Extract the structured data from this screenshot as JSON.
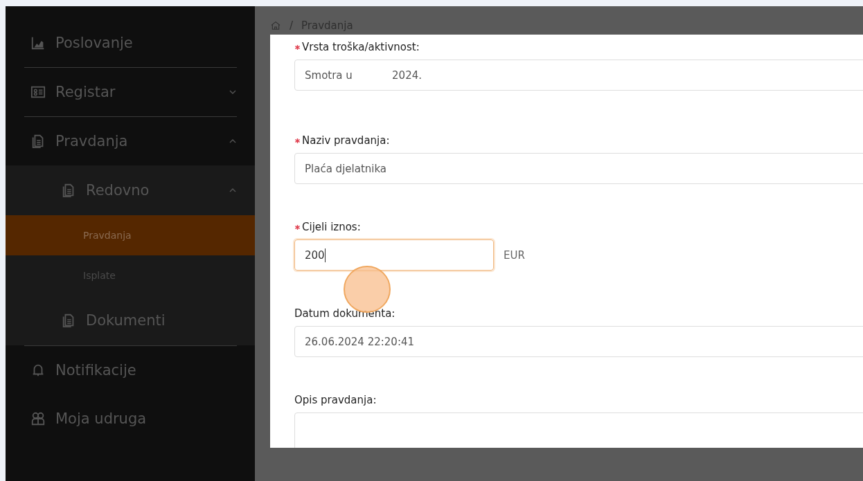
{
  "sidebar": {
    "items": [
      {
        "label": "Poslovanje",
        "divider": true
      },
      {
        "label": "Registar",
        "expanded": false,
        "divider": true
      },
      {
        "label": "Pravdanja",
        "expanded": true,
        "divider": true,
        "children": [
          {
            "label": "Redovno",
            "expanded": true,
            "children": [
              {
                "label": "Pravdanja",
                "selected": true
              },
              {
                "label": "Isplate",
                "selected": false
              }
            ]
          },
          {
            "label": "Dokumenti"
          }
        ]
      },
      {
        "label": "Notifikacije"
      },
      {
        "label": "Moja udruga"
      }
    ]
  },
  "breadcrumb": {
    "separator": "/",
    "items": [
      "Pravdanja"
    ]
  },
  "form": {
    "fields": [
      {
        "kind": "text",
        "label": "Vrsta troška/aktivnost:",
        "required": true,
        "value": "Smotra u            2024.",
        "focused": false
      },
      {
        "kind": "text",
        "label": "Naziv pravdanja:",
        "required": true,
        "value": "Plaća djelatnika",
        "focused": false
      },
      {
        "kind": "amount",
        "label": "Cijeli iznos:",
        "required": true,
        "value": "200",
        "unit": "EUR",
        "focused": true
      },
      {
        "kind": "text",
        "label": "Datum dokumenta:",
        "required": false,
        "value": "26.06.2024 22:20:41",
        "focused": false
      },
      {
        "kind": "textarea",
        "label": "Opis pravdanja:",
        "required": false,
        "focused": false
      }
    ]
  }
}
